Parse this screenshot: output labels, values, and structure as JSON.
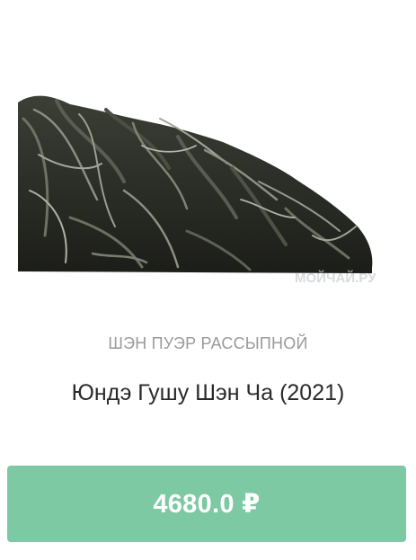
{
  "product": {
    "image_icon": "tea-leaves-image",
    "image_watermark": "МОЙЧАЙ.РУ",
    "category": "ШЭН ПУЭР РАССЫПНОЙ",
    "title": "Юндэ Гушу Шэн Ча (2021)",
    "price_label": "4680.0 ₽"
  },
  "colors": {
    "button_background": "#7dc9a3",
    "button_text": "#ffffff",
    "category_text": "#9a9a9a",
    "title_text": "#2a2a2a"
  }
}
